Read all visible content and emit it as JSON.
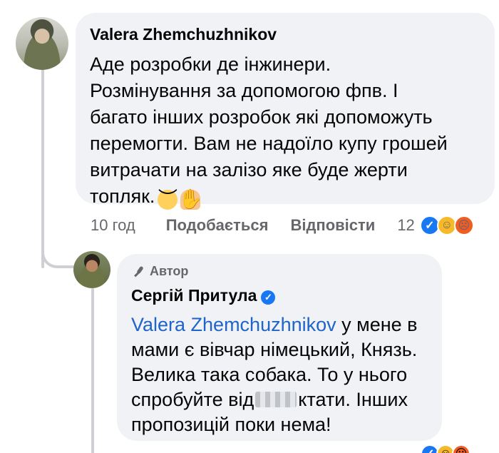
{
  "comment": {
    "author": "Valera Zhemchuzhnikov",
    "text": "Аде розробки де інжинери.\nРозмінування за допомогою фпв. І\nбагато інших розробок які допоможуть\nперемогти. Вам не надоїло купу грошей\nвитрачати на залізо яке буде жерти\nтопляк.",
    "emoji": [
      "pensive-face",
      "facepalm"
    ],
    "time": "10 год",
    "like_action": "Подобається",
    "reply_action": "Відповісти",
    "reaction_count": "12",
    "reactions": [
      "like",
      "haha",
      "angry"
    ]
  },
  "reply": {
    "badge": "Автор",
    "author": "Сергій Притула",
    "verified": true,
    "mention": "Valera Zhemchuzhnikov",
    "text_part1": " у мене в\nмами є вівчар німецький, Князь.\nВелика така собака. То у нього\nспробуйте від",
    "text_part2": "ктати. Інших\nпропозицій поки нема!"
  },
  "colors": {
    "bubble": "#f0f2f5",
    "secondary_text": "#65676b",
    "link": "#1f64c9",
    "like": "#1877f2"
  }
}
